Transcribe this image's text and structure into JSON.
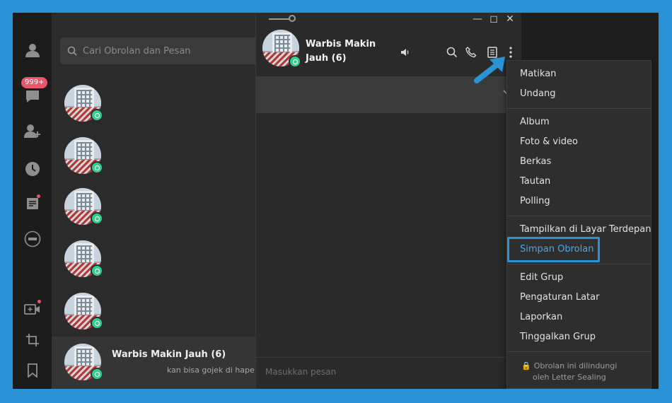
{
  "rail": {
    "badge": "999+"
  },
  "search": {
    "placeholder": "Cari Obrolan dan Pesan"
  },
  "list": {
    "active_chat": {
      "title": "Warbis Makin Jauh (6)",
      "preview": "kan bisa gojek di hape l"
    }
  },
  "chat": {
    "title": "Warbis Makin Jauh (6)",
    "composer_placeholder": "Masukkan pesan"
  },
  "menu": {
    "items": [
      "Matikan",
      "Undang",
      "Album",
      "Foto & video",
      "Berkas",
      "Tautan",
      "Polling",
      "Tampilkan di Layar Terdepan",
      "Simpan Obrolan",
      "Edit Grup",
      "Pengaturan Latar",
      "Laporkan",
      "Tinggalkan Grup"
    ],
    "footer_line1": "Obrolan ini dilindungi",
    "footer_line2": "oleh Letter Sealing"
  },
  "colors": {
    "accent": "#2a93d5",
    "badge": "#e8576b",
    "group_badge": "#2fcf8f"
  }
}
